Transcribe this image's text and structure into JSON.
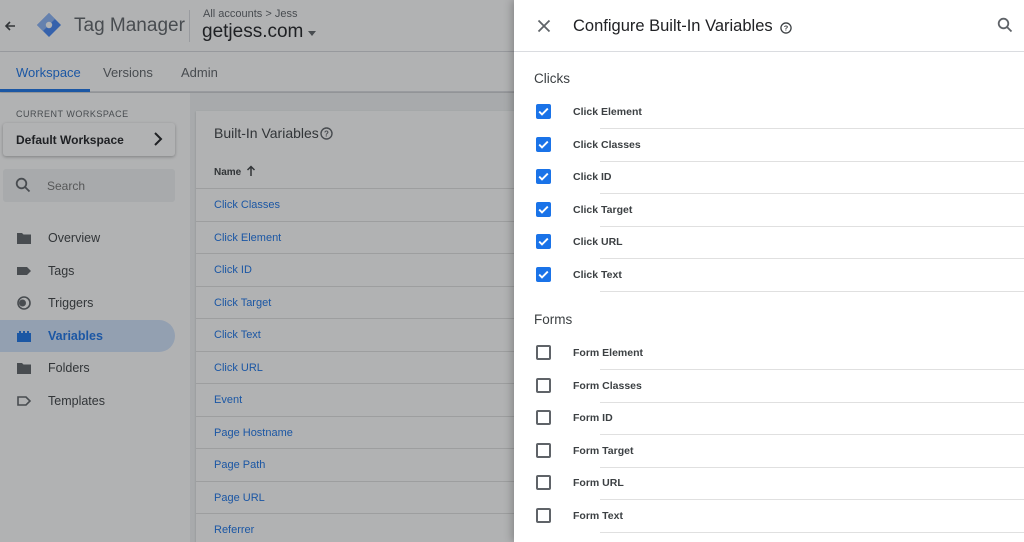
{
  "header": {
    "product_name": "Tag Manager",
    "breadcrumb": "All accounts > Jess",
    "container_name": "getjess.com"
  },
  "nav": {
    "tabs": [
      {
        "label": "Workspace"
      },
      {
        "label": "Versions"
      },
      {
        "label": "Admin"
      }
    ]
  },
  "sidebar": {
    "current_workspace_label": "CURRENT WORKSPACE",
    "workspace_name": "Default Workspace",
    "search_placeholder": "Search",
    "items": [
      {
        "label": "Overview",
        "icon": "folder-icon"
      },
      {
        "label": "Tags",
        "icon": "tag-icon"
      },
      {
        "label": "Triggers",
        "icon": "trigger-icon"
      },
      {
        "label": "Variables",
        "icon": "variables-icon"
      },
      {
        "label": "Folders",
        "icon": "folder-icon"
      },
      {
        "label": "Templates",
        "icon": "template-icon"
      }
    ]
  },
  "builtin_card": {
    "title": "Built-In Variables",
    "column_header": "Name",
    "rows": [
      "Click Classes",
      "Click Element",
      "Click ID",
      "Click Target",
      "Click Text",
      "Click URL",
      "Event",
      "Page Hostname",
      "Page Path",
      "Page URL",
      "Referrer"
    ]
  },
  "dialog": {
    "title": "Configure Built-In Variables",
    "sections": [
      {
        "heading": "Clicks",
        "items": [
          {
            "label": "Click Element",
            "checked": true
          },
          {
            "label": "Click Classes",
            "checked": true
          },
          {
            "label": "Click ID",
            "checked": true
          },
          {
            "label": "Click Target",
            "checked": true
          },
          {
            "label": "Click URL",
            "checked": true
          },
          {
            "label": "Click Text",
            "checked": true
          }
        ]
      },
      {
        "heading": "Forms",
        "items": [
          {
            "label": "Form Element",
            "checked": false
          },
          {
            "label": "Form Classes",
            "checked": false
          },
          {
            "label": "Form ID",
            "checked": false
          },
          {
            "label": "Form Target",
            "checked": false
          },
          {
            "label": "Form URL",
            "checked": false
          },
          {
            "label": "Form Text",
            "checked": false
          }
        ]
      }
    ]
  },
  "colors": {
    "accent": "#1a73e8",
    "active_nav_bg": "#d2e3fc"
  }
}
